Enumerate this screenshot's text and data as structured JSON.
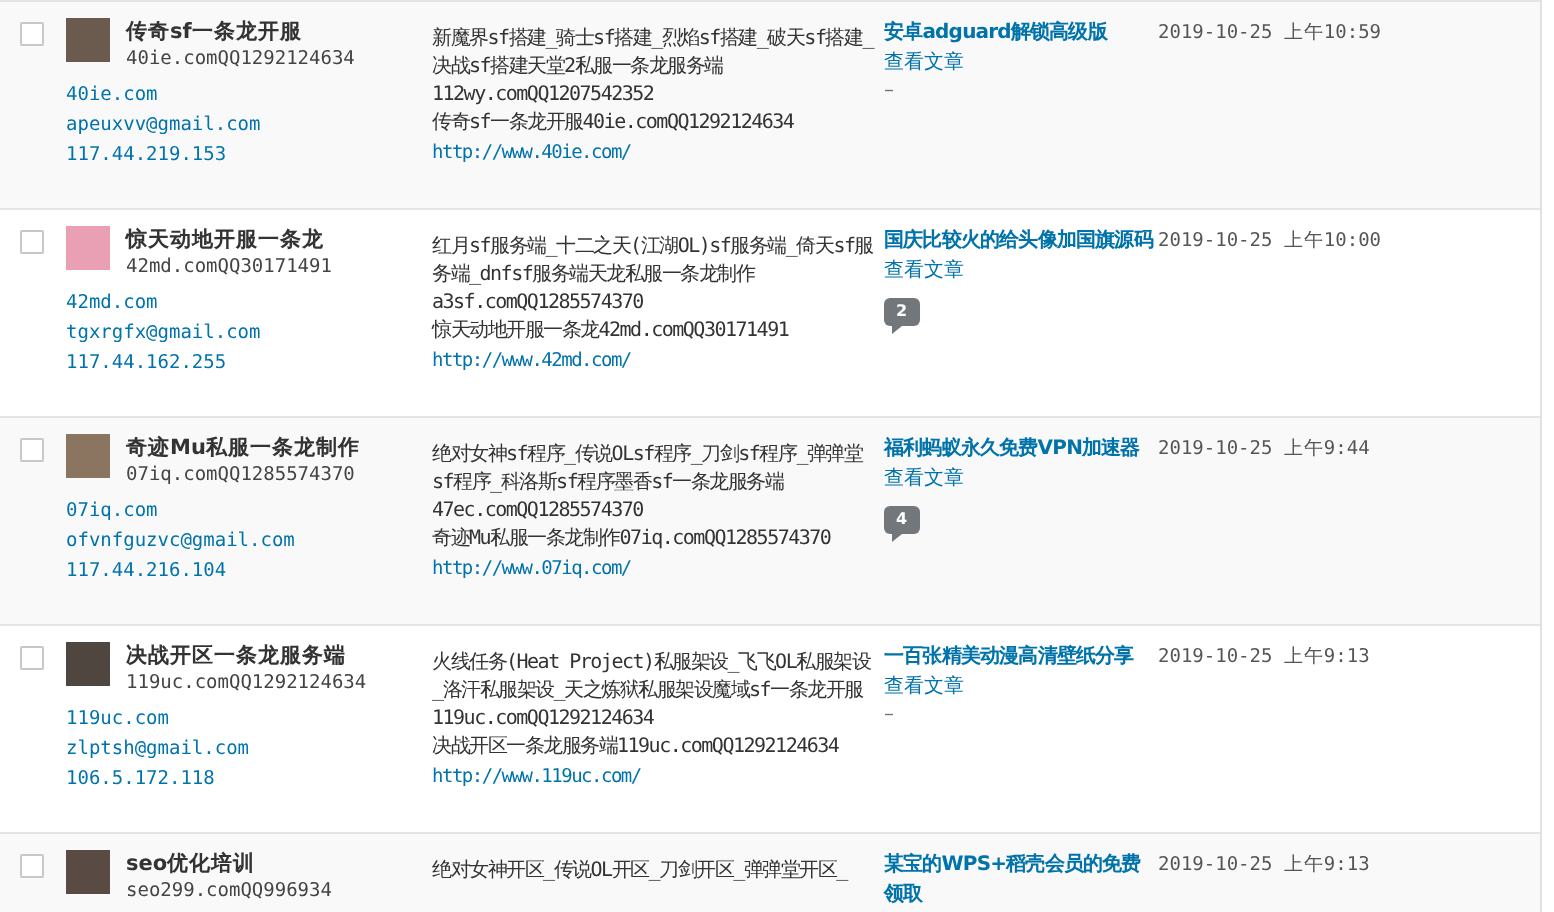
{
  "comments": [
    {
      "checked": false,
      "author": {
        "name": "传奇sf一条龙开服",
        "meta": "40ie.comQQ1292124634",
        "url": "40ie.com",
        "email": "apeuxvv@gmail.com",
        "ip": "117.44.219.153"
      },
      "comment": {
        "paragraphs": [
          "新魔界sf搭建_骑士sf搭建_烈焰sf搭建_破天sf搭建_决战sf搭建天堂2私服一条龙服务端",
          "112wy.comQQ1207542352",
          "传奇sf一条龙开服40ie.comQQ1292124634"
        ],
        "link": "http://www.40ie.com/"
      },
      "response": {
        "post": "安卓adguard解锁高级版",
        "view": "查看文章",
        "kind": "dash",
        "text": "–"
      },
      "date": "2019-10-25 上午10:59"
    },
    {
      "checked": false,
      "author": {
        "name": "惊天动地开服一条龙",
        "meta": "42md.comQQ30171491",
        "url": "42md.com",
        "email": "tgxrgfx@gmail.com",
        "ip": "117.44.162.255"
      },
      "comment": {
        "paragraphs": [
          "红月sf服务端_十二之天(江湖OL)sf服务端_倚天sf服务端_dnfsf服务端天龙私服一条龙制作",
          "a3sf.comQQ1285574370",
          "惊天动地开服一条龙42md.comQQ30171491"
        ],
        "link": "http://www.42md.com/"
      },
      "response": {
        "post": "国庆比较火的给头像加国旗源码",
        "view": "查看文章",
        "kind": "bubble",
        "text": "2"
      },
      "date": "2019-10-25 上午10:00"
    },
    {
      "checked": false,
      "author": {
        "name": "奇迹Mu私服一条龙制作",
        "meta": "07iq.comQQ1285574370",
        "url": "07iq.com",
        "email": "ofvnfguzvc@gmail.com",
        "ip": "117.44.216.104"
      },
      "comment": {
        "paragraphs": [
          "绝对女神sf程序_传说OLsf程序_刀剑sf程序_弹弹堂sf程序_科洛斯sf程序墨香sf一条龙服务端",
          "47ec.comQQ1285574370",
          "奇迹Mu私服一条龙制作07iq.comQQ1285574370"
        ],
        "link": "http://www.07iq.com/"
      },
      "response": {
        "post": "福利蚂蚁永久免费VPN加速器",
        "view": "查看文章",
        "kind": "bubble",
        "text": "4"
      },
      "date": "2019-10-25 上午9:44"
    },
    {
      "checked": false,
      "author": {
        "name": "决战开区一条龙服务端",
        "meta": "119uc.comQQ1292124634",
        "url": "119uc.com",
        "email": "zlptsh@gmail.com",
        "ip": "106.5.172.118"
      },
      "comment": {
        "paragraphs": [
          "火线任务(Heat Project)私服架设_飞飞OL私服架设_洛汗私服架设_天之炼狱私服架设魔域sf一条龙开服119uc.comQQ1292124634",
          "决战开区一条龙服务端119uc.comQQ1292124634"
        ],
        "link": "http://www.119uc.com/"
      },
      "response": {
        "post": "一百张精美动漫高清壁纸分享",
        "view": "查看文章",
        "kind": "dash",
        "text": "–"
      },
      "date": "2019-10-25 上午9:13"
    },
    {
      "checked": false,
      "author": {
        "name": "seo优化培训",
        "meta": "seo299.comQQ996934"
      },
      "comment": {
        "paragraphs": [
          "绝对女神开区_传说OL开区_刀剑开区_弹弹堂开区_"
        ]
      },
      "response": {
        "post": "某宝的WPS+稻壳会员的免费领取"
      },
      "date": "2019-10-25 上午9:13"
    }
  ]
}
